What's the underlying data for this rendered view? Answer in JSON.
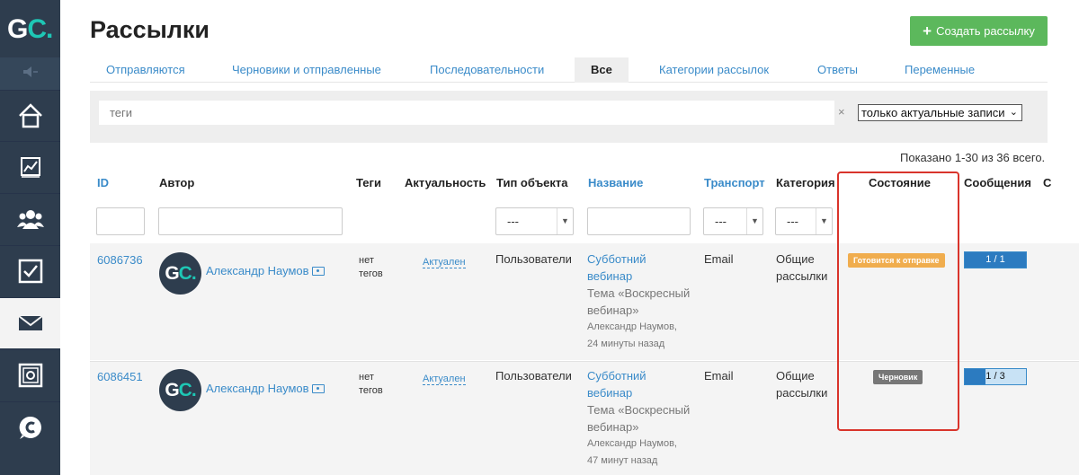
{
  "sidebar": {
    "logo_text_main": "G",
    "logo_text_accent": "C.",
    "items": [
      "speaker-icon",
      "home-icon",
      "chart-icon",
      "users-icon",
      "tasks-icon",
      "mail-icon",
      "safe-icon",
      "chat-icon"
    ]
  },
  "header": {
    "title": "Рассылки",
    "create_button": "Создать рассылку"
  },
  "tabs": [
    {
      "label": "Отправляются"
    },
    {
      "label": "Черновики и отправленные"
    },
    {
      "label": "Последовательности"
    },
    {
      "label": "Все"
    },
    {
      "label": "Категории рассылок"
    },
    {
      "label": "Ответы"
    },
    {
      "label": "Переменные"
    }
  ],
  "filters": {
    "tags_placeholder": "теги",
    "clear": "×",
    "actual_select": "только актуальные записи",
    "select_default": "---"
  },
  "shown_text": "Показано 1-30 из 36 всего.",
  "columns": {
    "id": "ID",
    "author": "Автор",
    "tags": "Теги",
    "actuality": "Актуальность",
    "object_type": "Тип объекта",
    "name": "Название",
    "transport": "Транспорт",
    "category": "Категория",
    "state": "Состояние",
    "messages": "Сообщения",
    "extra": "С"
  },
  "rows": [
    {
      "id": "6086736",
      "author": "Александр Наумов",
      "avatar": "GC.",
      "tags_line1": "нет",
      "tags_line2": "тегов",
      "actuality": "Актуален",
      "object_type": "Пользователи",
      "title_line1": "Субботний",
      "title_line2": "вебинар",
      "subtitle_line1": "Тема «Воскресный",
      "subtitle_line2": "вебинар»",
      "meta_line1": "Александр Наумов,",
      "meta_line2": "24 минуты назад",
      "transport": "Email",
      "category_line1": "Общие",
      "category_line2": "рассылки",
      "state": "Готовится к отправке",
      "state_color": "#f0ad4e",
      "messages": "1 / 1",
      "progress": 1.0
    },
    {
      "id": "6086451",
      "author": "Александр Наумов",
      "avatar": "GC.",
      "tags_line1": "нет",
      "tags_line2": "тегов",
      "actuality": "Актуален",
      "object_type": "Пользователи",
      "title_line1": "Субботний",
      "title_line2": "вебинар",
      "subtitle_line1": "Тема «Воскресный",
      "subtitle_line2": "вебинар»",
      "meta_line1": "Александр Наумов,",
      "meta_line2": "47 минут назад",
      "transport": "Email",
      "category_line1": "Общие",
      "category_line2": "рассылки",
      "state": "Черновик",
      "state_color": "#777777",
      "messages": "1 / 3",
      "progress": 0.333
    }
  ],
  "colors": {
    "sidebar": "#2e3d4e",
    "accent": "#1ec7b5",
    "link": "#3a8bc9",
    "create_button": "#5cb85c",
    "highlight": "#d9342b"
  }
}
